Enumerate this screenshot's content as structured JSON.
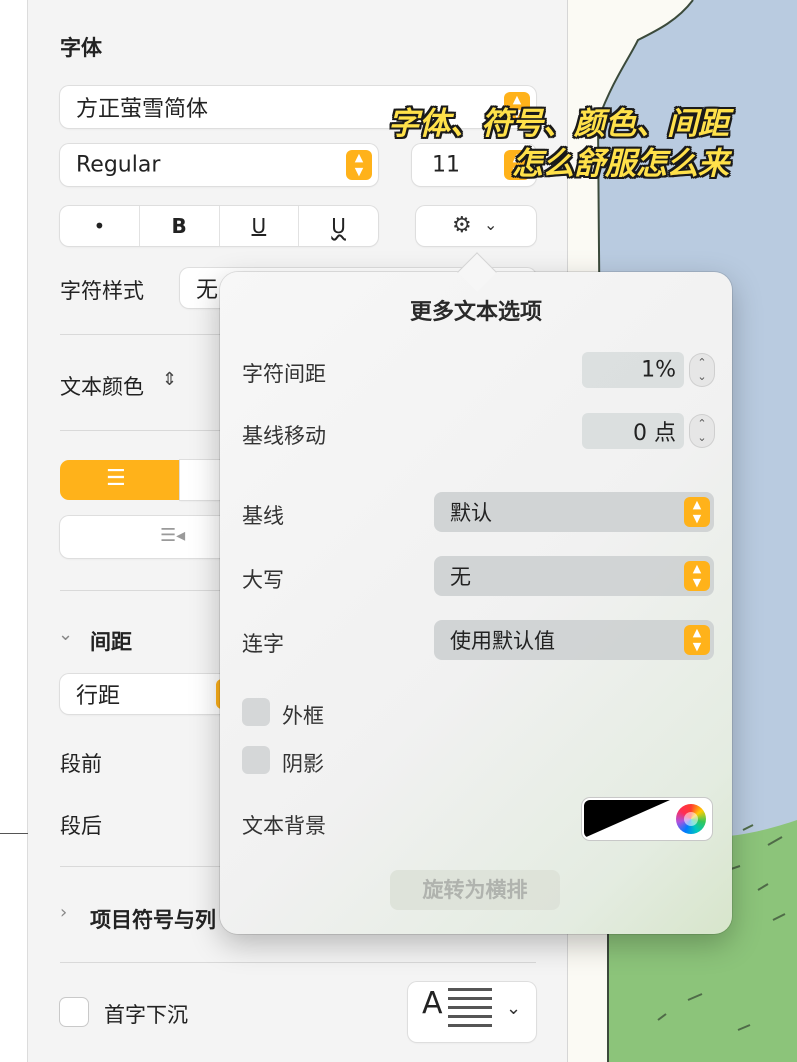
{
  "font_section": {
    "title": "字体",
    "family": "方正萤雪简体",
    "weight": "Regular",
    "size": "11",
    "style_buttons": [
      "•",
      "B",
      "U",
      "U"
    ]
  },
  "char_style": {
    "label": "字符样式",
    "value": "无"
  },
  "text_color": {
    "label": "文本颜色"
  },
  "spacing": {
    "header": "间距",
    "line_spacing": "行距",
    "before": "段前",
    "after": "段后"
  },
  "bullets": {
    "label": "项目符号与列"
  },
  "drop_cap": {
    "label": "首字下沉",
    "icon_letter": "A"
  },
  "popover": {
    "title": "更多文本选项",
    "char_spacing": {
      "label": "字符间距",
      "value": "1%"
    },
    "baseline_shift": {
      "label": "基线移动",
      "value": "0 点"
    },
    "baseline": {
      "label": "基线",
      "value": "默认"
    },
    "caps": {
      "label": "大写",
      "value": "无"
    },
    "ligature": {
      "label": "连字",
      "value": "使用默认值"
    },
    "outline": {
      "label": "外框"
    },
    "shadow": {
      "label": "阴影"
    },
    "text_bg": {
      "label": "文本背景"
    },
    "rotate_button": "旋转为横排"
  },
  "overlay": {
    "line1": "字体、符号、颜色、间距",
    "line2": "怎么舒服怎么来"
  },
  "colors": {
    "accent": "#ffb21a",
    "overlay_text": "#ffe14a",
    "sky": "#b9cbe0",
    "grass": "#8cc47a"
  }
}
